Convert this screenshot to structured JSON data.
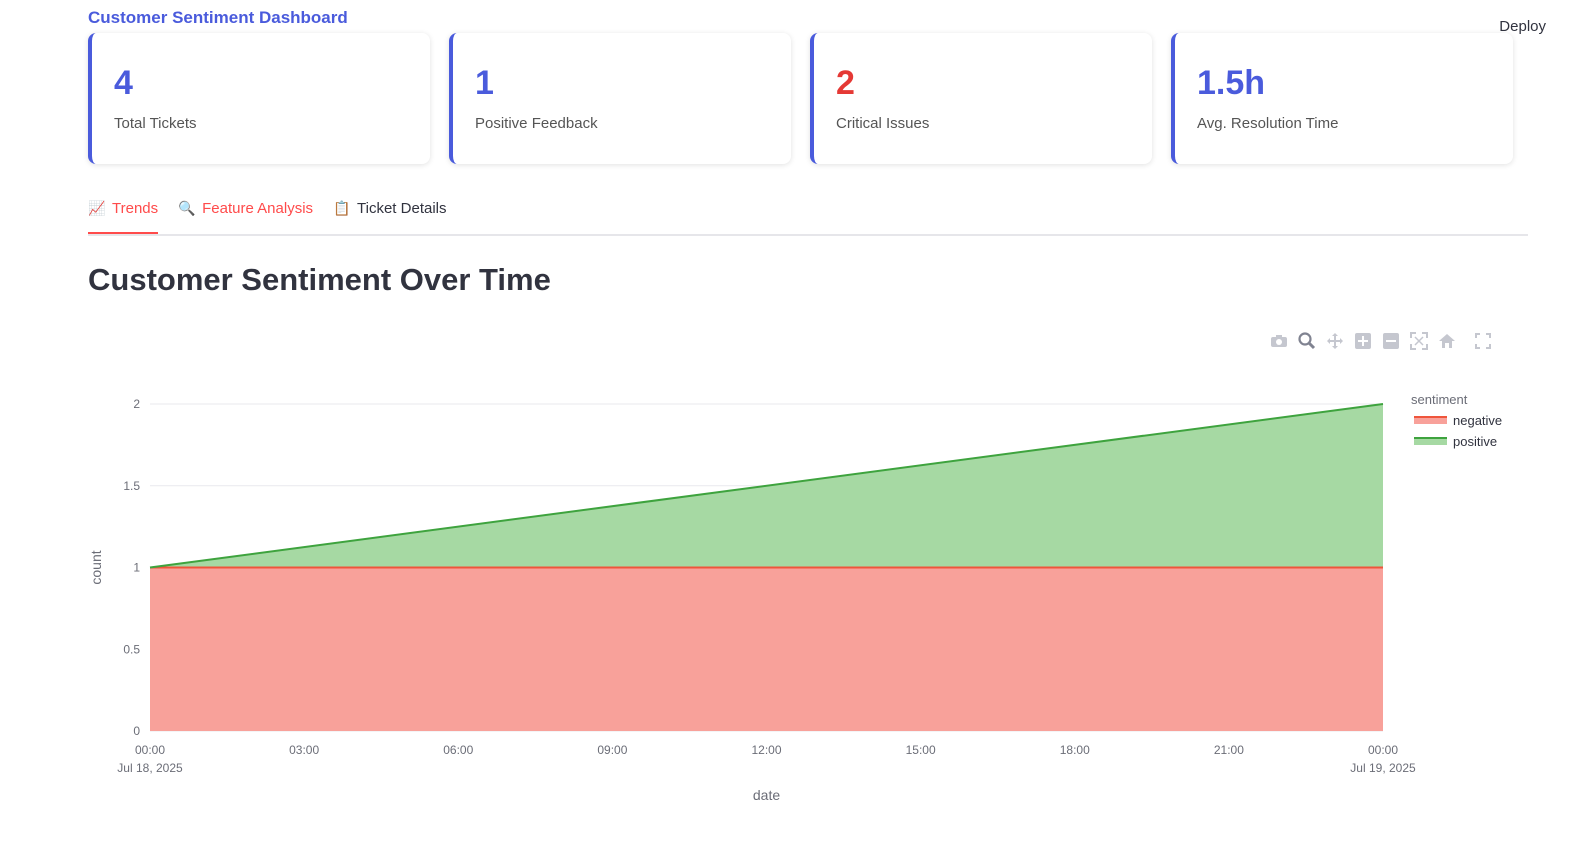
{
  "app": {
    "title": "Customer Sentiment Dashboard",
    "deploy_label": "Deploy"
  },
  "metrics": [
    {
      "value": "4",
      "label": "Total Tickets"
    },
    {
      "value": "1",
      "label": "Positive Feedback"
    },
    {
      "value": "2",
      "label": "Critical Issues"
    },
    {
      "value": "1.5h",
      "label": "Avg. Resolution Time"
    }
  ],
  "tabs": [
    {
      "icon": "📈",
      "label": "Trends"
    },
    {
      "icon": "🔍",
      "label": "Feature Analysis"
    },
    {
      "icon": "📋",
      "label": "Ticket Details"
    }
  ],
  "section": {
    "title": "Customer Sentiment Over Time"
  },
  "modebar": [
    "camera-icon",
    "zoom-icon",
    "pan-icon",
    "zoom-in-icon",
    "zoom-out-icon",
    "autoscale-icon",
    "reset-axes-icon",
    "fullscreen-icon"
  ],
  "chart_data": {
    "type": "area",
    "xlabel": "date",
    "ylabel": "count",
    "x": [
      "2025-07-18 00:00",
      "2025-07-19 00:00"
    ],
    "x_ticks": [
      {
        "line1": "00:00",
        "line2": "Jul 18, 2025"
      },
      {
        "line1": "03:00",
        "line2": ""
      },
      {
        "line1": "06:00",
        "line2": ""
      },
      {
        "line1": "09:00",
        "line2": ""
      },
      {
        "line1": "12:00",
        "line2": ""
      },
      {
        "line1": "15:00",
        "line2": ""
      },
      {
        "line1": "18:00",
        "line2": ""
      },
      {
        "line1": "21:00",
        "line2": ""
      },
      {
        "line1": "00:00",
        "line2": "Jul 19, 2025"
      }
    ],
    "y_ticks": [
      "0",
      "0.5",
      "1",
      "1.5",
      "2"
    ],
    "ylim": [
      0,
      2
    ],
    "stacked": true,
    "grid": true,
    "legend_title": "sentiment",
    "legend_position": "top-right",
    "series": [
      {
        "name": "negative",
        "values": [
          1,
          1
        ],
        "color": "#ef553b",
        "fill": "#f8a19a"
      },
      {
        "name": "positive",
        "values": [
          0,
          1
        ],
        "color": "#3ea33e",
        "fill": "#a6d9a3"
      }
    ]
  }
}
